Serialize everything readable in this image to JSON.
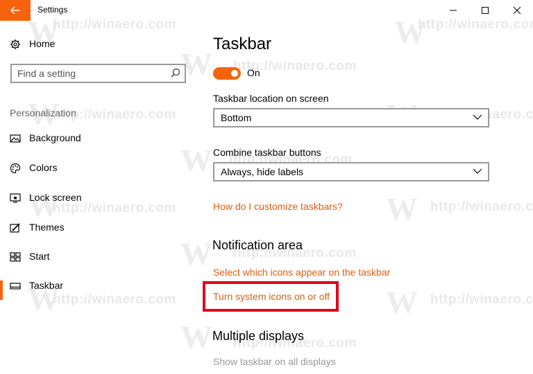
{
  "window": {
    "title": "Settings"
  },
  "watermark": "http://winaero.com",
  "sidebar": {
    "home": "Home",
    "search_placeholder": "Find a setting",
    "group": "Personalization",
    "items": [
      {
        "label": "Background",
        "icon": "picture-icon"
      },
      {
        "label": "Colors",
        "icon": "palette-icon"
      },
      {
        "label": "Lock screen",
        "icon": "lock-screen-icon"
      },
      {
        "label": "Themes",
        "icon": "themes-icon"
      },
      {
        "label": "Start",
        "icon": "start-icon"
      },
      {
        "label": "Taskbar",
        "icon": "taskbar-icon",
        "selected": true
      }
    ]
  },
  "main": {
    "title": "Taskbar",
    "toggle": {
      "state": "On"
    },
    "location": {
      "label": "Taskbar location on screen",
      "value": "Bottom"
    },
    "combine": {
      "label": "Combine taskbar buttons",
      "value": "Always, hide labels"
    },
    "help_link": "How do I customize taskbars?",
    "notification": {
      "heading": "Notification area",
      "link1": "Select which icons appear on the taskbar",
      "link2": "Turn system icons on or off"
    },
    "multiple": {
      "heading": "Multiple displays",
      "show_all": "Show taskbar on all displays"
    }
  },
  "colors": {
    "accent": "#f7630c",
    "link": "#e35a0c",
    "highlight": "#e3001b"
  }
}
